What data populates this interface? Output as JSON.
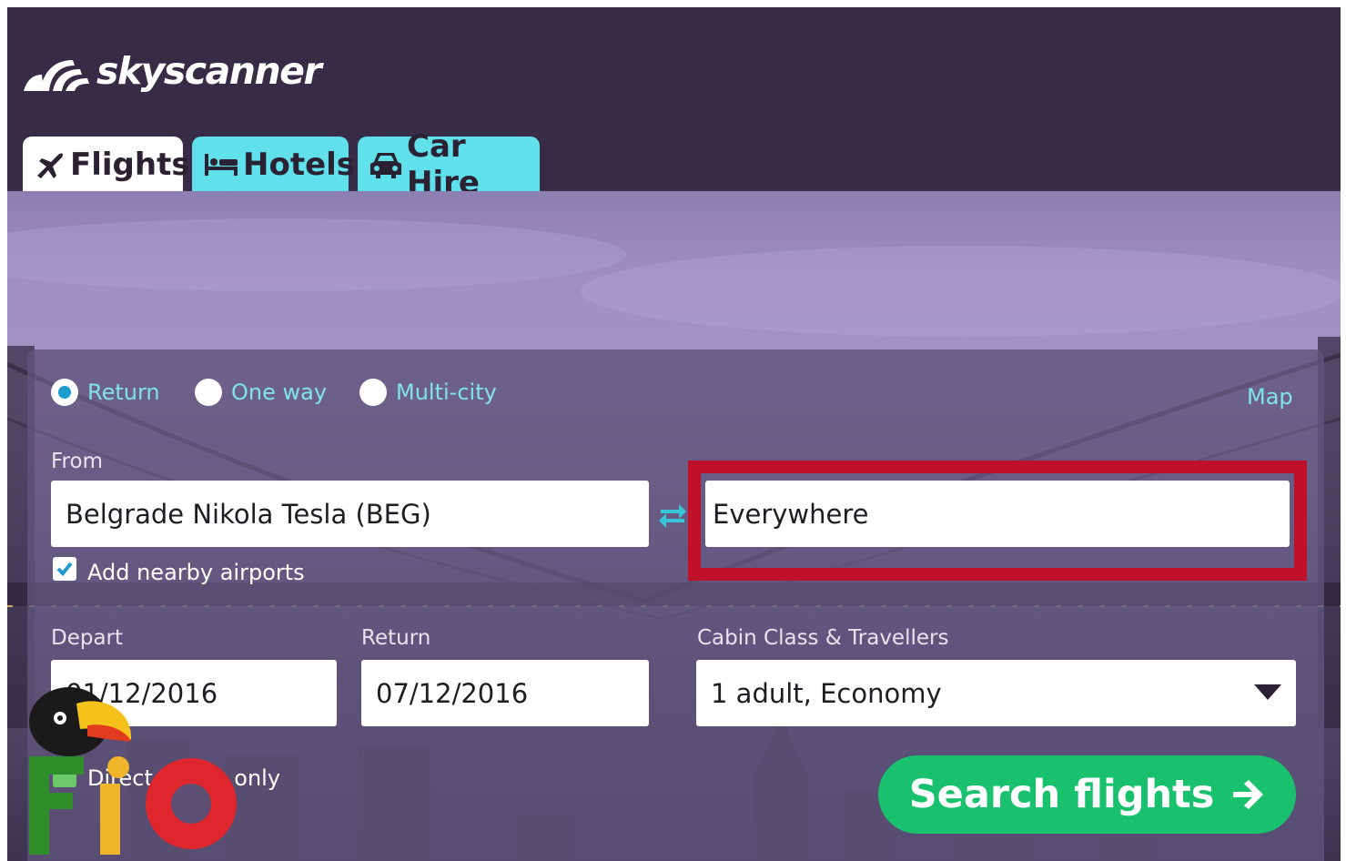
{
  "brand": {
    "name": "skyscanner"
  },
  "tabs": [
    {
      "label": "Flights",
      "icon": "plane-icon",
      "active": true
    },
    {
      "label": "Hotels",
      "icon": "bed-icon",
      "active": false
    },
    {
      "label": "Car Hire",
      "icon": "car-icon",
      "active": false
    }
  ],
  "trip_type": {
    "options": [
      "Return",
      "One way",
      "Multi-city"
    ],
    "selected": "Return"
  },
  "map_link": "Map",
  "from": {
    "label": "From",
    "value": "Belgrade Nikola Tesla (BEG)",
    "nearby_label": "Add nearby airports",
    "nearby_checked": true
  },
  "to": {
    "value": "Everywhere"
  },
  "depart": {
    "label": "Depart",
    "value": "01/12/2016"
  },
  "return": {
    "label": "Return",
    "value": "07/12/2016"
  },
  "cabin": {
    "label": "Cabin Class & Travellers",
    "value": "1 adult, Economy"
  },
  "direct": {
    "label": "Direct flights only"
  },
  "search_button": "Search flights",
  "colors": {
    "header_bg": "#382b46",
    "tab_active": "#ffffff",
    "tab_inactive": "#5fe0ea",
    "link": "#7fe3ee",
    "search_button": "#19c16f",
    "highlight": "#c0112b"
  }
}
